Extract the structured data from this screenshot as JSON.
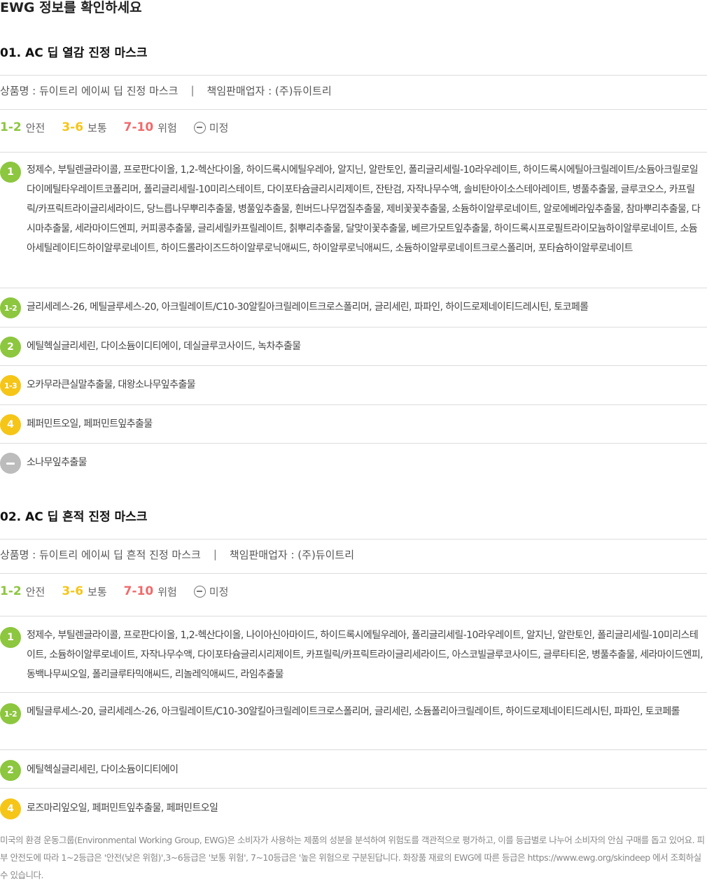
{
  "page_title": "EWG 정보를 확인하세요",
  "colors": {
    "safe": "#8dc63f",
    "moderate": "#f5c518",
    "danger": "#ee6b6b",
    "undetermined": "#bcbcbc"
  },
  "legend": {
    "safe_range": "1-2",
    "safe_label": "안전",
    "moderate_range": "3-6",
    "moderate_label": "보통",
    "danger_range": "7-10",
    "danger_label": "위험",
    "undetermined_label": "미정"
  },
  "products": [
    {
      "title": "01. AC 딥 열감 진정 마스크",
      "name_label": "상품명 : 듀이트리 에이씨 딥 진정 마스크",
      "separator": "|",
      "seller_label": "책임판매업자 : (주)듀이트리",
      "ingredients": [
        {
          "grade": "1",
          "level": "safe",
          "text": "정제수, 부틸렌글라이콜, 프로판다이올, 1,2-헥산다이올, 하이드록시에틸우레아, 알지닌, 알란토인, 폴리글리세릴-10라우레이트, 하이드록시에틸아크릴레이트/소듐아크릴로일다이메틸타우레이트코폴리머, 폴리글리세릴-10미리스테이트, 다이포타슘글리시리제이트, 잔탄검, 자작나무수액, 솔비탄아이소스테아레이트, 병풀추출물, 글루코오스, 카프릴릭/카프릭트라이글리세라이드, 당느릅나무뿌리추출물, 병풀잎추출물, 흰버드나무껍질추출물, 제비꽃꽃추출물, 소듐하이알루로네이트, 알로에베라잎추출물, 참마뿌리추출물, 다시마추출물, 세라마이드엔피, 커피콩추출물, 글리세릴카프릴레이트, 칡뿌리추출물, 달맞이꽃추출물, 베르가모트잎추출물, 하이드록시프로필트라이모늄하이알루로네이트, 소듐아세틸레이티드하이알루로네이트, 하이드롤라이즈드하이알루로닉애씨드, 하이알루로닉애씨드, 소듐하이알루로네이트크로스폴리머, 포타슘하이알루로네이트"
        },
        {
          "grade": "1-2",
          "level": "safe",
          "text": "글리세레스-26, 메틸글루세스-20, 아크릴레이트/C10-30알킬아크릴레이트크로스폴리머, 글리세린, 파파인, 하이드로제네이티드레시틴, 토코페롤"
        },
        {
          "grade": "2",
          "level": "safe",
          "text": "에틸헥실글리세린, 다이소듐이디티에이, 데실글루코사이드, 녹차추출물"
        },
        {
          "grade": "1-3",
          "level": "moderate",
          "text": "오카무라큰실말추출물, 대왕소나무잎추출물"
        },
        {
          "grade": "4",
          "level": "moderate",
          "text": "페퍼민트오일, 페퍼민트잎추출물"
        },
        {
          "grade": "",
          "level": "undetermined",
          "text": "소나무잎추출물"
        }
      ]
    },
    {
      "title": "02. AC 딥 흔적 진정 마스크",
      "name_label": "상품명 : 듀이트리 에이씨 딥 흔적 진정 마스크",
      "separator": "|",
      "seller_label": "책임판매업자 : (주)듀이트리",
      "ingredients": [
        {
          "grade": "1",
          "level": "safe",
          "text": "정제수, 부틸렌글라이콜, 프로판다이올, 1,2-헥산다이올, 나이아신아마이드, 하이드록시에틸우레아, 폴리글리세릴-10라우레이트, 알지닌, 알란토인, 폴리글리세릴-10미리스테이트, 소듐하이알루로네이트, 자작나무수액, 다이포타슘글리시리제이트, 카프릴릭/카프릭트라이글리세라이드, 아스코빌글루코사이드, 글루타티온, 병풀추출물, 세라마이드엔피, 동백나무씨오일, 폴리글루타믹애씨드, 리놀레익애씨드, 라임추출물"
        },
        {
          "grade": "1-2",
          "level": "safe",
          "text": "메틸글루세스-20, 글리세레스-26, 아크릴레이트/C10-30알킬아크릴레이트크로스폴리머, 글리세린, 소듐폴리아크릴레이트, 하이드로제네이티드레시틴, 파파인, 토코페롤"
        },
        {
          "grade": "2",
          "level": "safe",
          "text": "에틸헥실글리세린, 다이소듐이디티에이"
        },
        {
          "grade": "4",
          "level": "moderate",
          "text": "로즈마리잎오일, 페퍼민트잎추출물, 페퍼민트오일"
        }
      ]
    }
  ],
  "footnote": "미국의 환경 운동그룹(Environmental Working Group, EWG)은 소비자가 사용하는 제품의 성분을 분석하여 위험도를 객관적으로 평가하고, 이를 등급별로 나누어 소비자의 안심 구매를 돕고 있어요. 피부 안전도에 따라 1~2등급은 '안전(낮은 위험)',3~6등급은 '보통 위험', 7~10등급은 '높은 위험으로 구분된답니다. 화장품 재료의 EWG에 따른 등급은 https://www.ewg.org/skindeep 에서 조회하실 수 있습니다."
}
